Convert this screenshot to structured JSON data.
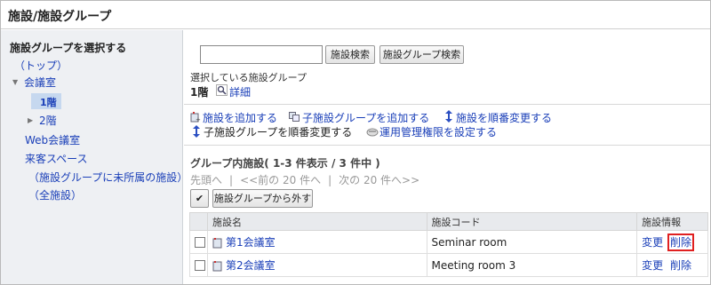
{
  "page_title": "施設/施設グループ",
  "sidebar": {
    "heading": "施設グループを選択する",
    "items": [
      {
        "label": "（トップ）"
      },
      {
        "label": "会議室"
      },
      {
        "label": "1階"
      },
      {
        "label": "2階"
      },
      {
        "label": "Web会議室"
      },
      {
        "label": "来客スペース"
      },
      {
        "label": "（施設グループに未所属の施設）"
      },
      {
        "label": "（全施設）"
      }
    ]
  },
  "search": {
    "input_value": "",
    "search_button": "施設検索",
    "group_search_button": "施設グループ検索"
  },
  "selected_group": {
    "caption": "選択している施設グループ",
    "name": "1階",
    "detail_link": "詳細"
  },
  "actions": {
    "add_facility": "施設を追加する",
    "add_child_group": "子施設グループを追加する",
    "reorder_facilities": "施設を順番変更する",
    "reorder_child_groups": "子施設グループを順番変更する",
    "set_permissions": "運用管理権限を設定する"
  },
  "list_section": {
    "title": "グループ内施設( 1-3 件表示 / 3 件中 )",
    "pager_first": "先頭へ",
    "pager_prev": "<<前の 20 件へ",
    "pager_next": "次の 20 件へ>>",
    "check_all": "✔",
    "remove_button": "施設グループから外す"
  },
  "table": {
    "headers": [
      "施設名",
      "施設コード",
      "施設情報"
    ],
    "rows": [
      {
        "name": "第1会議室",
        "code": "Seminar room",
        "edit": "変更",
        "delete": "削除"
      },
      {
        "name": "第2会議室",
        "code": "Meeting room 3",
        "edit": "変更",
        "delete": "削除"
      }
    ]
  },
  "colors": {
    "link": "#1a3fb8",
    "sidebar_bg": "#eef0f3",
    "selected_bg": "#c6d8ef",
    "highlight": "#e02020"
  }
}
